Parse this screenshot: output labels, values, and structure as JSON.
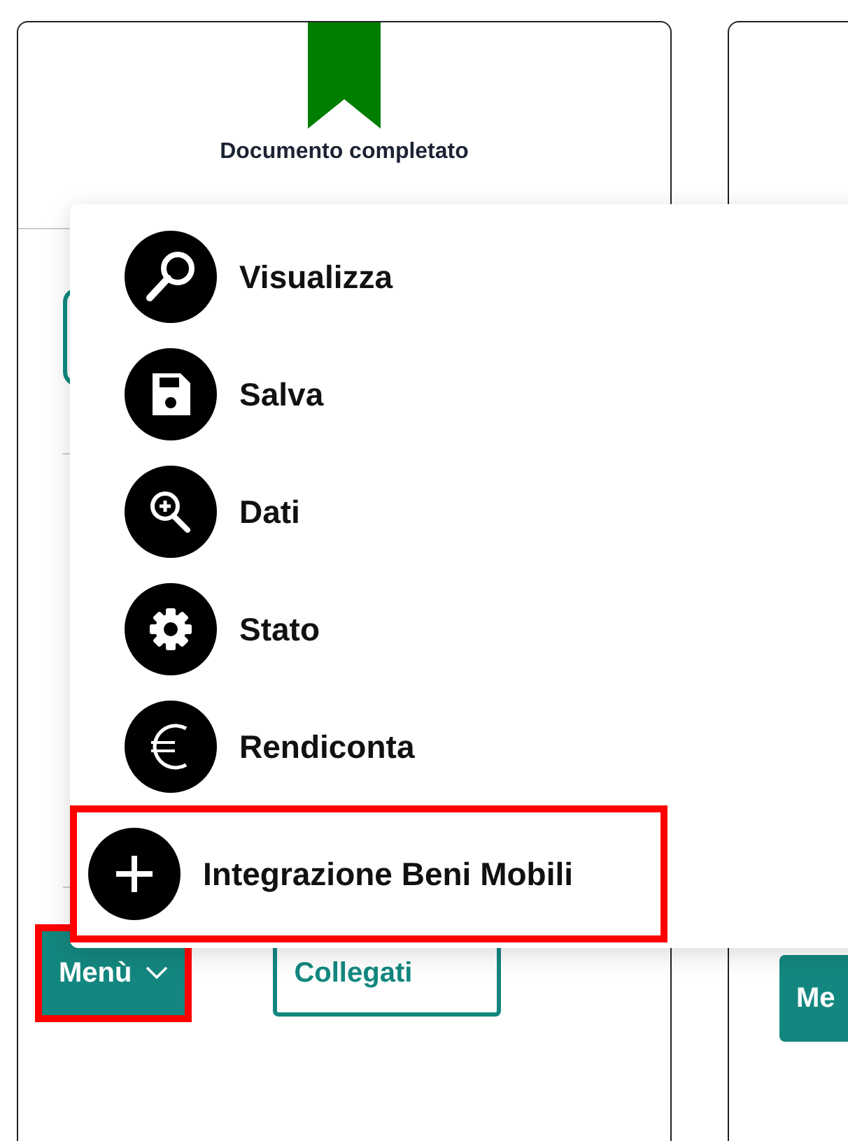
{
  "card": {
    "status": "Documento completato",
    "menu_button": {
      "label": "Menù",
      "expanded": true,
      "highlighted": true
    },
    "linked_button": {
      "label": "Collegati"
    }
  },
  "next_card": {
    "menu_button": {
      "label": "Me"
    }
  },
  "menu": {
    "items": [
      {
        "kind": "view",
        "label": "Visualizza",
        "highlighted": false
      },
      {
        "kind": "save",
        "label": "Salva",
        "highlighted": false
      },
      {
        "kind": "zoom",
        "label": "Dati",
        "highlighted": false
      },
      {
        "kind": "gear",
        "label": "Stato",
        "highlighted": false
      },
      {
        "kind": "euro",
        "label": "Rendiconta",
        "highlighted": false
      },
      {
        "kind": "plus",
        "label": "Integrazione Beni Mobili",
        "highlighted": true
      }
    ]
  }
}
